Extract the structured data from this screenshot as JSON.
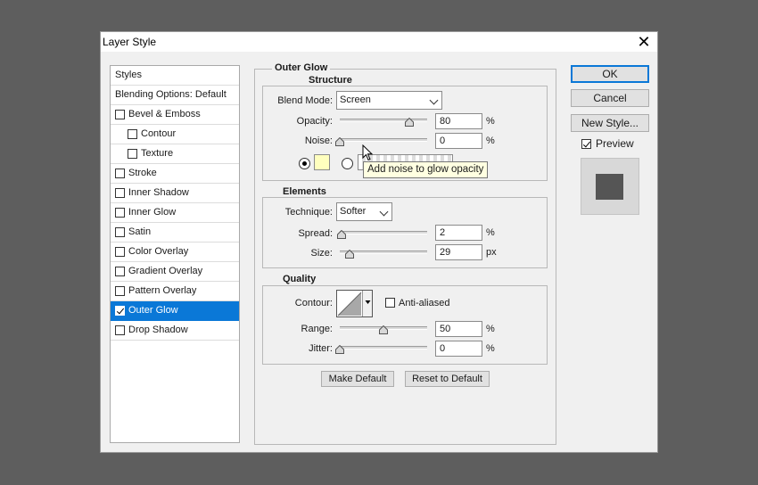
{
  "window": {
    "title": "Layer Style"
  },
  "styles_list": {
    "items": [
      {
        "label": "Styles",
        "checkbox": false,
        "checked": false,
        "indent": 0
      },
      {
        "label": "Blending Options: Default",
        "checkbox": false,
        "checked": false,
        "indent": 0
      },
      {
        "label": "Bevel & Emboss",
        "checkbox": true,
        "checked": false,
        "indent": 0
      },
      {
        "label": "Contour",
        "checkbox": true,
        "checked": false,
        "indent": 1
      },
      {
        "label": "Texture",
        "checkbox": true,
        "checked": false,
        "indent": 1
      },
      {
        "label": "Stroke",
        "checkbox": true,
        "checked": false,
        "indent": 0
      },
      {
        "label": "Inner Shadow",
        "checkbox": true,
        "checked": false,
        "indent": 0
      },
      {
        "label": "Inner Glow",
        "checkbox": true,
        "checked": false,
        "indent": 0
      },
      {
        "label": "Satin",
        "checkbox": true,
        "checked": false,
        "indent": 0
      },
      {
        "label": "Color Overlay",
        "checkbox": true,
        "checked": false,
        "indent": 0
      },
      {
        "label": "Gradient Overlay",
        "checkbox": true,
        "checked": false,
        "indent": 0
      },
      {
        "label": "Pattern Overlay",
        "checkbox": true,
        "checked": false,
        "indent": 0
      },
      {
        "label": "Outer Glow",
        "checkbox": true,
        "checked": true,
        "indent": 0,
        "selected": true
      },
      {
        "label": "Drop Shadow",
        "checkbox": true,
        "checked": false,
        "indent": 0
      }
    ]
  },
  "outer_glow": {
    "title": "Outer Glow",
    "structure": {
      "title": "Structure",
      "blend_mode_label": "Blend Mode:",
      "blend_mode_value": "Screen",
      "opacity_label": "Opacity:",
      "opacity_value": "80",
      "opacity_level": 0.8,
      "opacity_unit": "%",
      "noise_label": "Noise:",
      "noise_value": "0",
      "noise_level": 0.0,
      "noise_unit": "%",
      "glow_color": "#ffffbe",
      "color_radio_selected": true,
      "tooltip": "Add noise to glow opacity"
    },
    "elements": {
      "title": "Elements",
      "technique_label": "Technique:",
      "technique_value": "Softer",
      "spread_label": "Spread:",
      "spread_value": "2",
      "spread_level": 0.02,
      "spread_unit": "%",
      "size_label": "Size:",
      "size_value": "29",
      "size_level": 0.116,
      "size_unit": "px"
    },
    "quality": {
      "title": "Quality",
      "contour_label": "Contour:",
      "anti_aliased_label": "Anti-aliased",
      "anti_aliased_checked": false,
      "range_label": "Range:",
      "range_value": "50",
      "range_level": 0.5,
      "range_unit": "%",
      "jitter_label": "Jitter:",
      "jitter_value": "0",
      "jitter_level": 0.0,
      "jitter_unit": "%"
    },
    "make_default_label": "Make Default",
    "reset_default_label": "Reset to Default"
  },
  "buttons": {
    "ok": "OK",
    "cancel": "Cancel",
    "new_style": "New Style...",
    "preview_label": "Preview",
    "preview_checked": true
  },
  "colors": {
    "accent": "#0a78d7",
    "preview_swatch": "#555555"
  }
}
